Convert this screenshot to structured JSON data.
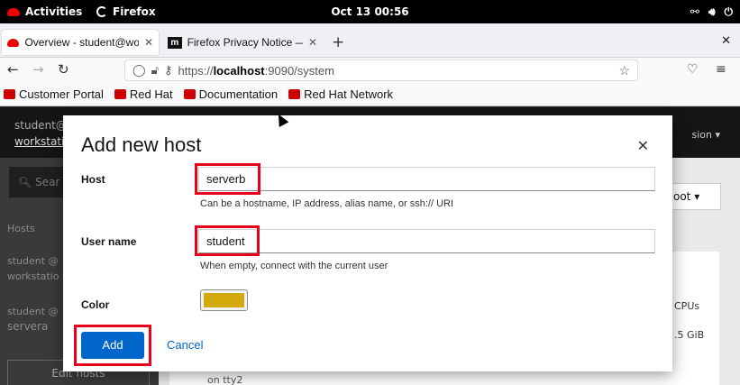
{
  "topbar": {
    "activities": "Activities",
    "app_name": "Firefox",
    "clock": "Oct 13  00:56",
    "tray_icons": [
      "network-icon",
      "volume-icon",
      "power-icon"
    ]
  },
  "browser": {
    "tabs": [
      {
        "label": "Overview - student@wor",
        "active": true
      },
      {
        "label": "Firefox Privacy Notice —",
        "active": false
      }
    ],
    "new_tab": "+",
    "url_prefix": "https://",
    "url_host": "localhost",
    "url_rest": ":9090/system",
    "bookmarks": [
      "Customer Portal",
      "Red Hat",
      "Documentation",
      "Red Hat Network"
    ]
  },
  "cockpit": {
    "user": "student@",
    "host": "workstati",
    "session": "sion",
    "search_placeholder": "Sear",
    "hosts_label": "Hosts",
    "hosts": [
      {
        "user": "student @",
        "name": "workstatio"
      },
      {
        "user": "student @",
        "name": "servera"
      }
    ],
    "edit_hosts": "Edit hosts",
    "root_label": "oot",
    "cpus": "CPUs",
    "memory": ".5 GiB",
    "tty": "on tty2"
  },
  "modal": {
    "title": "Add new host",
    "host_label": "Host",
    "host_value": "serverb",
    "host_helper": "Can be a hostname, IP address, alias name, or ssh:// URI",
    "username_label": "User name",
    "username_value": "student",
    "username_helper": "When empty, connect with the current user",
    "color_label": "Color",
    "color_value": "#d4a90b",
    "add_label": "Add",
    "cancel_label": "Cancel"
  },
  "annotation_color": "#e8001c"
}
